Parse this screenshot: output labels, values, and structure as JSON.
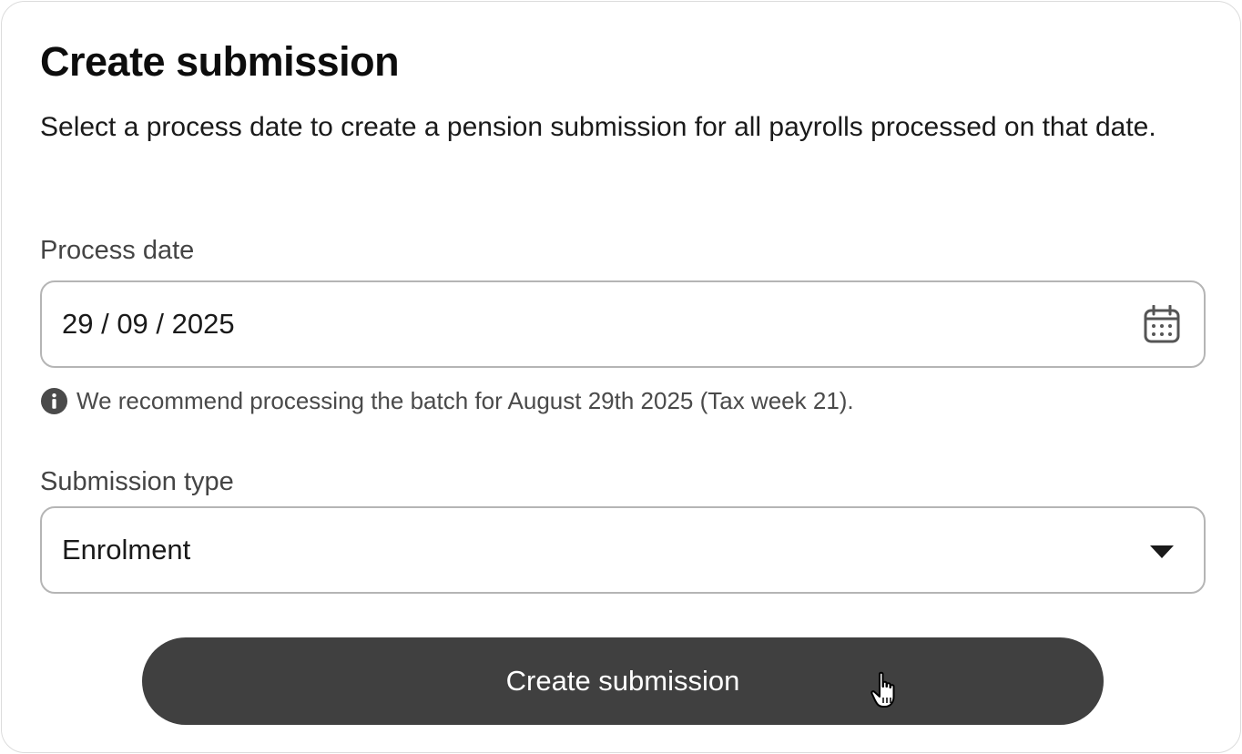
{
  "header": {
    "title": "Create submission",
    "description": "Select a process date to create a pension submission for all payrolls processed on that date."
  },
  "process_date": {
    "label": "Process date",
    "value": "29 / 09 / 2025",
    "icon": "calendar-icon",
    "hint": "We recommend processing the batch for August 29th 2025 (Tax week 21).",
    "hint_icon": "info-icon"
  },
  "submission_type": {
    "label": "Submission type",
    "selected": "Enrolment",
    "icon": "chevron-down-icon"
  },
  "actions": {
    "create_label": "Create submission"
  },
  "colors": {
    "button_bg": "#404040",
    "border": "#b5b5b5",
    "text": "#111111",
    "muted_text": "#444444"
  }
}
